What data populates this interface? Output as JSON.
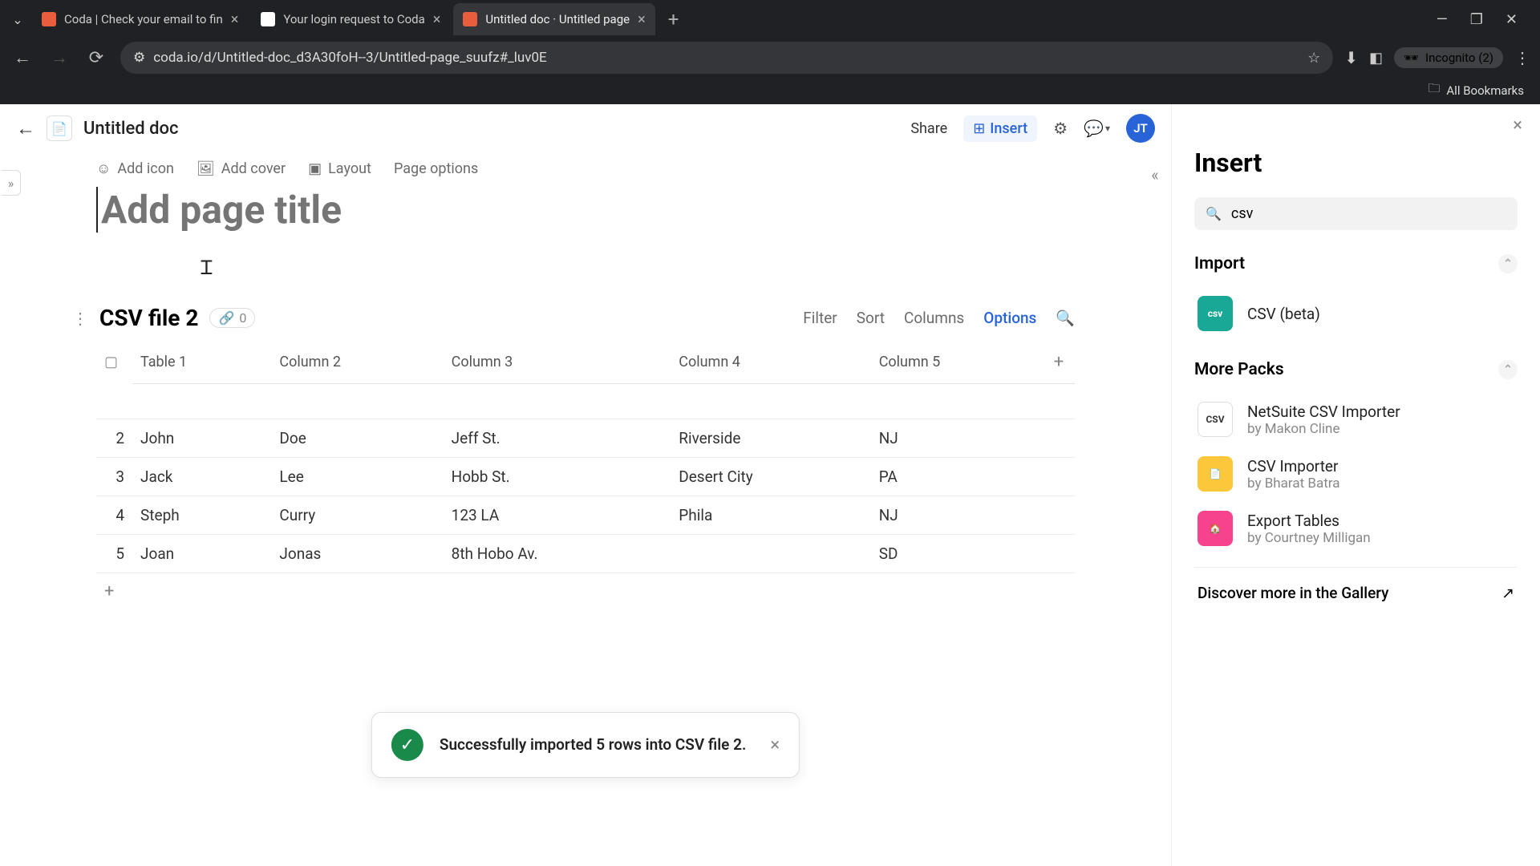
{
  "browser": {
    "tabs": [
      {
        "title": "Coda | Check your email to fin"
      },
      {
        "title": "Your login request to Coda"
      },
      {
        "title": "Untitled doc · Untitled page"
      }
    ],
    "url": "coda.io/d/Untitled-doc_d3A30foH--3/Untitled-page_suufz#_luv0E",
    "incognito": "Incognito (2)",
    "bookmarks": "All Bookmarks"
  },
  "header": {
    "doc_title": "Untitled doc",
    "share": "Share",
    "insert": "Insert",
    "avatar": "JT"
  },
  "page_actions": {
    "add_icon": "Add icon",
    "add_cover": "Add cover",
    "layout": "Layout",
    "page_options": "Page options"
  },
  "page_title_placeholder": "Add page title",
  "table": {
    "name": "CSV file 2",
    "link_count": "0",
    "controls": {
      "filter": "Filter",
      "sort": "Sort",
      "columns": "Columns",
      "options": "Options"
    },
    "cols": [
      "Table 1",
      "Column 2",
      "Column 3",
      "Column 4",
      "Column 5"
    ],
    "rows": [
      {
        "n": "2",
        "c": [
          "John",
          "Doe",
          "Jeff St.",
          "Riverside",
          "NJ"
        ]
      },
      {
        "n": "3",
        "c": [
          "Jack",
          "Lee",
          "Hobb St.",
          "Desert City",
          "PA"
        ]
      },
      {
        "n": "4",
        "c": [
          "Steph",
          "Curry",
          "123 LA",
          "Phila",
          "NJ"
        ]
      },
      {
        "n": "5",
        "c": [
          "Joan",
          "Jonas",
          "8th Hobo Av.",
          "",
          "SD"
        ]
      }
    ]
  },
  "toast": {
    "message": "Successfully imported 5 rows into CSV file 2."
  },
  "panel": {
    "title": "Insert",
    "search": "csv",
    "import_section": "Import",
    "csv_item": "CSV (beta)",
    "more_packs": "More Packs",
    "packs": [
      {
        "name": "NetSuite CSV Importer",
        "author": "by Makon Cline"
      },
      {
        "name": "CSV Importer",
        "author": "by Bharat Batra"
      },
      {
        "name": "Export Tables",
        "author": "by Courtney Milligan"
      }
    ],
    "gallery": "Discover more in the Gallery"
  }
}
